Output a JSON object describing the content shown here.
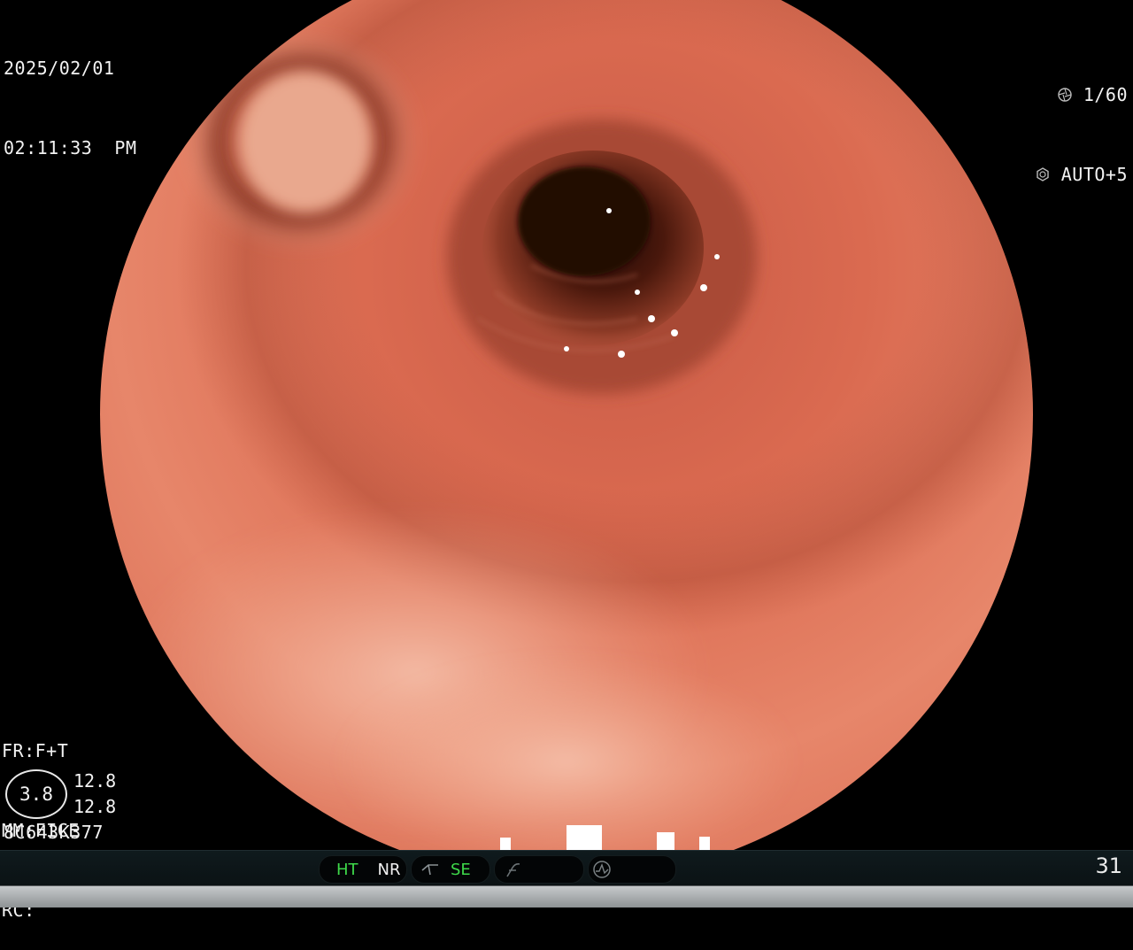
{
  "overlay": {
    "date": "2025/02/01",
    "time": "02:11:33  PM",
    "shutter": "1/60",
    "exposure": "AUTO+5",
    "fr": "FR:F+T",
    "mm": "MM:FICE",
    "rc": "RC:",
    "gauge_value": "3.8",
    "gauge_val_1": "12.8",
    "gauge_val_2": "12.8",
    "serial": "8C643K377"
  },
  "statusbar": {
    "ht": "HT",
    "nr": "NR",
    "se": "SE",
    "frame_count": "31"
  },
  "colors": {
    "mucosa": "#d9694f",
    "lumen": "#3a1208",
    "indicator_green": "#3ed94a"
  }
}
